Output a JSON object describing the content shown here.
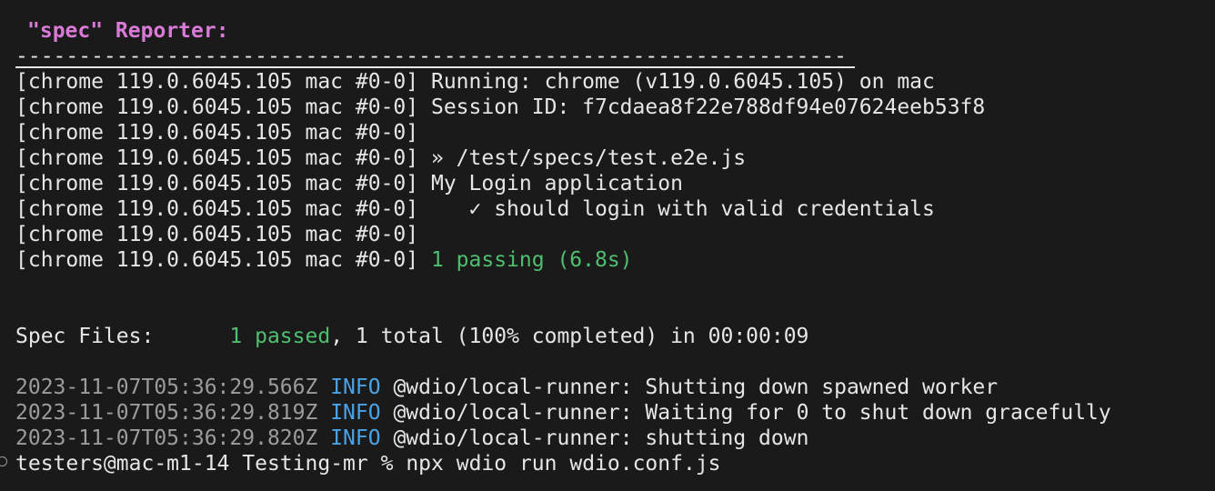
{
  "reporter_heading": "\"spec\" Reporter:",
  "separator": "------------------------------------------------------------------",
  "log_prefix": "[chrome 119.0.6045.105 mac #0-0]",
  "log_lines": [
    {
      "text": "Running: chrome (v119.0.6045.105) on mac",
      "style": "plain"
    },
    {
      "text": "Session ID: f7cdaea8f22e788df94e07624eeb53f8",
      "style": "plain"
    },
    {
      "text": "",
      "style": "plain"
    },
    {
      "text": "» /test/specs/test.e2e.js",
      "style": "plain"
    },
    {
      "text": "My Login application",
      "style": "plain"
    },
    {
      "text": "   ✓ should login with valid credentials",
      "style": "plain"
    },
    {
      "text": "",
      "style": "plain"
    },
    {
      "text": "1 passing (6.8s)",
      "style": "green"
    }
  ],
  "summary": {
    "label": "Spec Files:",
    "passed": "1 passed",
    "rest": ", 1 total (100% completed) in 00:00:09"
  },
  "info_lines": [
    {
      "timestamp": "2023-11-07T05:36:29.566Z",
      "level": "INFO",
      "message": "@wdio/local-runner: Shutting down spawned worker"
    },
    {
      "timestamp": "2023-11-07T05:36:29.819Z",
      "level": "INFO",
      "message": "@wdio/local-runner: Waiting for 0 to shut down gracefully"
    },
    {
      "timestamp": "2023-11-07T05:36:29.820Z",
      "level": "INFO",
      "message": "@wdio/local-runner: shutting down"
    }
  ],
  "prompt": {
    "user_host": "testers@mac-m1-14",
    "directory": "Testing-mr",
    "symbol": "%",
    "command": "npx wdio run wdio.conf.js"
  },
  "colors": {
    "background": "#1a1a1a",
    "text": "#e6e6e6",
    "heading": "#d97ad7",
    "success": "#4fbf6f",
    "timestamp": "#9c9c9c",
    "info": "#4aa3e6"
  }
}
